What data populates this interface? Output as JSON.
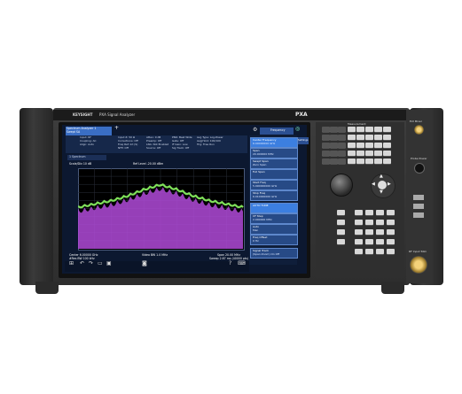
{
  "instrument": {
    "brand": "KEYSIGHT",
    "model_line": "PXA Signal Analyzer",
    "model_badge": "PXA"
  },
  "screen": {
    "app_tab": "Spectrum Analyzer 1",
    "app_tab_sub": "Swept SA",
    "mode_menu": "Frequency",
    "settings_tab": "Settings",
    "status": {
      "col1": [
        "Input: RF",
        "Coupling: AC",
        "Align: Auto"
      ],
      "col2": [
        "Input Z: 50 Ω",
        "Corrections: Off",
        "Freq Ref: Int (S)",
        "NFE: Off"
      ],
      "col3": [
        "Atten: 0 dB",
        "Preamp: Off",
        "LNA: Not Enabled",
        "Source: Off"
      ],
      "col4": [
        "PNO: Best Wide",
        "Gate: Off",
        "IF Gain: Low",
        "Sig Track: Off"
      ],
      "col5": [
        "Avg Type: Log-Power",
        "Avg|Hold: 100/100",
        "Trig: Free Run"
      ]
    },
    "trace_tab": "1 Spectrum",
    "scale_label": "Scale/Div 10 dB",
    "ref_level": "Ref Level -20.00 dBm",
    "bottom": {
      "center": "Center 6.00000 GHz",
      "res_bw": "#Res BW 100 kHz",
      "video_bw": "Video BW 1.0 MHz",
      "span": "Span 20.00 MHz",
      "sweep": "Sweep 2.67 ms (40000 pts)"
    },
    "softkeys": [
      {
        "label": "Center Frequency",
        "value": "6.00000000 GHz",
        "highlight": true
      },
      {
        "label": "Span",
        "value": "20.000000 MHz",
        "highlight": false
      },
      {
        "label": "Swept Span",
        "value": "Zero Span",
        "highlight": false
      },
      {
        "label": "Full Span",
        "value": "",
        "highlight": false
      },
      {
        "label": "Start Freq",
        "value": "5.990000000 GHz",
        "highlight": false
      },
      {
        "label": "Stop Freq",
        "value": "6.010000000 GHz",
        "highlight": false
      },
      {
        "label": "AUTO TUNE",
        "value": "",
        "highlight": true
      },
      {
        "label": "CF Step",
        "value": "2.000000 MHz",
        "highlight": false
      },
      {
        "label": "Auto",
        "value": "Man",
        "highlight": false
      },
      {
        "label": "Freq Offset",
        "value": "0 Hz",
        "highlight": false
      },
      {
        "label": "Signal Track",
        "value": "(Span Zoom) On Off",
        "highlight": false
      }
    ]
  },
  "front_panel": {
    "section_label": "Measurement",
    "ext_mixer": "Ext Mixer",
    "probe_power": "Probe Power",
    "rf_input": "RF Input 50Ω"
  },
  "colors": {
    "trace_green": "#7fe05a",
    "trace_purple": "#b04ad8",
    "ui_blue": "#3a6ec4"
  },
  "chart_data": {
    "type": "area",
    "title": "",
    "xlabel": "",
    "ylabel": "",
    "x_unit": "GHz",
    "x_range": [
      5.99,
      6.01
    ],
    "ylim": [
      -120,
      -20
    ],
    "series": [
      {
        "x": [
          5.99,
          5.992,
          5.994,
          5.996,
          5.998,
          6.0,
          6.002,
          6.004,
          6.006,
          6.008,
          6.01
        ],
        "values": [
          -72,
          -68,
          -64,
          -58,
          -50,
          -44,
          -50,
          -58,
          -64,
          -68,
          -72
        ]
      }
    ]
  }
}
